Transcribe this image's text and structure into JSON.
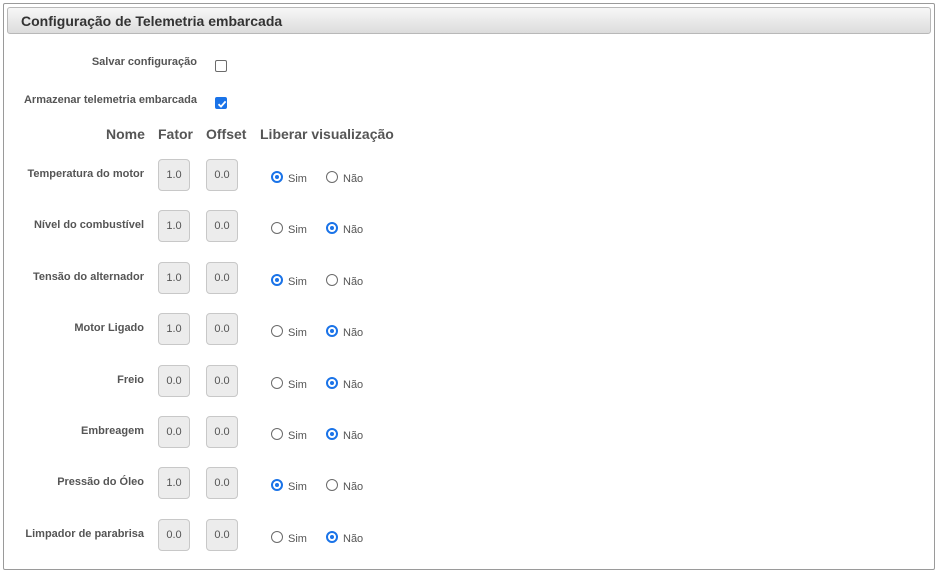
{
  "panel": {
    "title": "Configuração de Telemetria embarcada"
  },
  "options": {
    "save_config": {
      "label": "Salvar configuração",
      "checked": false
    },
    "store_telemetry": {
      "label": "Armazenar telemetria embarcada",
      "checked": true
    }
  },
  "columns": {
    "name": "Nome",
    "factor": "Fator",
    "offset": "Offset",
    "visibility": "Liberar visualização"
  },
  "radio_labels": {
    "yes": "Sim",
    "no": "Não"
  },
  "rows": [
    {
      "name": "Temperatura do motor",
      "factor": "1.0",
      "offset": "0.0",
      "visible": "sim"
    },
    {
      "name": "Nível do combustível",
      "factor": "1.0",
      "offset": "0.0",
      "visible": "nao"
    },
    {
      "name": "Tensão do alternador",
      "factor": "1.0",
      "offset": "0.0",
      "visible": "sim"
    },
    {
      "name": "Motor Ligado",
      "factor": "1.0",
      "offset": "0.0",
      "visible": "nao"
    },
    {
      "name": "Freio",
      "factor": "0.0",
      "offset": "0.0",
      "visible": "nao"
    },
    {
      "name": "Embreagem",
      "factor": "0.0",
      "offset": "0.0",
      "visible": "nao"
    },
    {
      "name": "Pressão do Óleo",
      "factor": "1.0",
      "offset": "0.0",
      "visible": "sim"
    },
    {
      "name": "Limpador de parabrisa",
      "factor": "0.0",
      "offset": "0.0",
      "visible": "nao"
    }
  ],
  "colors": {
    "accent": "#1a73e8",
    "header_top": "#f7f7f7",
    "header_bottom": "#dcdcdc"
  }
}
